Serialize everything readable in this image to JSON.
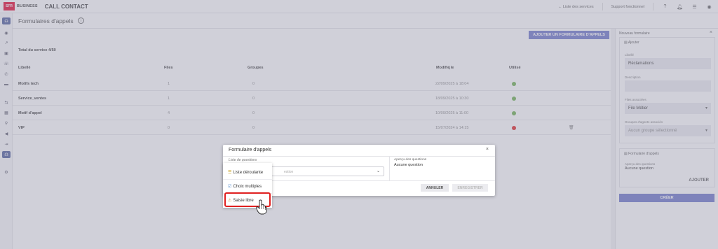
{
  "topbar": {
    "logo_text": "SFR",
    "brand": "BUSINESS",
    "app_name": "CALL CONTACT",
    "back_link": "← Liste des services",
    "support": "Support fonctionnel",
    "icons": [
      "help-icon",
      "bell-icon",
      "menu-icon",
      "user-icon"
    ]
  },
  "page": {
    "title": "Formulaires d'appels",
    "add_button": "AJOUTER UN FORMULAIRE D'APPELS",
    "total": "Total du service 4/50"
  },
  "table": {
    "headers": {
      "libelle": "Libellé",
      "files": "Files",
      "groupes": "Groupes",
      "modifie": "Modifié le",
      "utilise": "Utilisé"
    },
    "rows": [
      {
        "libelle": "Motifs tech",
        "files": "1",
        "groupes": "0",
        "modifie": "22/09/2025 à 18:04",
        "utilise": "green"
      },
      {
        "libelle": "Service_ventes",
        "files": "1",
        "groupes": "0",
        "modifie": "18/09/2025 à 10:30",
        "utilise": "green"
      },
      {
        "libelle": "Motif d'appel",
        "files": "4",
        "groupes": "0",
        "modifie": "10/09/2025 à 11:00",
        "utilise": "green"
      },
      {
        "libelle": "VIP",
        "files": "0",
        "groupes": "0",
        "modifie": "15/07/2024 à 14:15",
        "utilise": "red"
      }
    ]
  },
  "right_panel": {
    "title": "Nouveau formulaire",
    "section_add": "Ajouter",
    "libelle_label": "Libellé",
    "libelle_value": "Réclamations",
    "description_label": "Description",
    "description_value": "",
    "files_label": "Files associées",
    "files_value": "File Métier",
    "groupes_label": "Groupes d'agents associés",
    "groupes_value": "Aucun groupe sélectionné",
    "section_form": "Formulaire d'appels",
    "apercu_label": "Aperçu des questions",
    "apercu_value": "Aucune question",
    "ajouter": "AJOUTER",
    "creer": "CRÉER"
  },
  "modal": {
    "title": "Formulaire d'appels",
    "list_label": "Liste de questions",
    "select_placeholder": "estion",
    "apercu_label": "Aperçu des questions",
    "apercu_value": "Aucune question",
    "annuler": "ANNULER",
    "enregistrer": "ENREGISTRER"
  },
  "dropdown": {
    "items": [
      {
        "label": "Liste déroulante",
        "icon": "list-icon"
      },
      {
        "label": "Choix multiples",
        "icon": "checkbox-icon"
      },
      {
        "label": "Saisie libre",
        "icon": "edit-icon"
      }
    ]
  },
  "colors": {
    "accent": "#6b73c8",
    "status_green": "#6ab04c",
    "status_red": "#e02020",
    "highlight": "#e02020"
  }
}
